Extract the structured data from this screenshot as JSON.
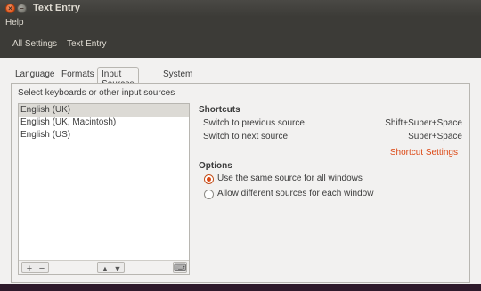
{
  "window": {
    "title": "Text Entry"
  },
  "menubar": {
    "items": [
      {
        "label": "Help"
      }
    ]
  },
  "toolbar": {
    "all_settings": "All Settings",
    "current": "Text Entry"
  },
  "tabs": [
    {
      "label": "Language",
      "active": false
    },
    {
      "label": "Formats",
      "active": false
    },
    {
      "label": "Input Sources",
      "active": true
    },
    {
      "label": "System",
      "active": false
    }
  ],
  "input_sources": {
    "caption": "Select keyboards or other input sources",
    "items": [
      {
        "label": "English (UK)",
        "selected": true
      },
      {
        "label": "English (UK, Macintosh)",
        "selected": false
      },
      {
        "label": "English (US)",
        "selected": false
      }
    ],
    "toolbar_icons": [
      "add-icon",
      "remove-icon",
      "move-up-icon",
      "move-down-icon",
      "keyboard-icon"
    ]
  },
  "shortcuts": {
    "title": "Shortcuts",
    "rows": [
      {
        "label": "Switch to previous source",
        "accel": "Shift+Super+Space"
      },
      {
        "label": "Switch to next source",
        "accel": "Super+Space"
      }
    ],
    "settings_link": "Shortcut Settings"
  },
  "options": {
    "title": "Options",
    "choices": [
      {
        "label": "Use the same source for all windows",
        "checked": true
      },
      {
        "label": "Allow different sources for each window",
        "checked": false
      }
    ]
  },
  "colors": {
    "accent": "#dd4814",
    "titlebar": "#3c3b37",
    "content_bg": "#f2f1f0"
  }
}
